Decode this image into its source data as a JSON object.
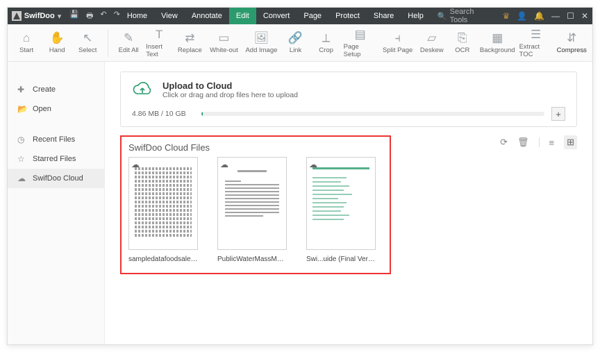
{
  "titlebar": {
    "app_name": "SwifDoo",
    "search_placeholder": "Search Tools"
  },
  "menu": {
    "items": [
      "Home",
      "View",
      "Annotate",
      "Edit",
      "Convert",
      "Page",
      "Protect",
      "Share",
      "Help"
    ],
    "active_index": 3
  },
  "ribbon": {
    "items": [
      {
        "label": "Start",
        "icon": "⌂"
      },
      {
        "label": "Hand",
        "icon": "✋"
      },
      {
        "label": "Select",
        "icon": "↖"
      },
      {
        "label": "Edit All",
        "icon": "✎"
      },
      {
        "label": "Insert Text",
        "icon": "T"
      },
      {
        "label": "Replace",
        "icon": "⇄"
      },
      {
        "label": "White-out",
        "icon": "▭"
      },
      {
        "label": "Add Image",
        "icon": "🖼"
      },
      {
        "label": "Link",
        "icon": "🔗"
      },
      {
        "label": "Crop",
        "icon": "⟂"
      },
      {
        "label": "Page Setup",
        "icon": "▤"
      },
      {
        "label": "Split Page",
        "icon": "⫞"
      },
      {
        "label": "Deskew",
        "icon": "▱"
      },
      {
        "label": "OCR",
        "icon": "⎘"
      },
      {
        "label": "Background",
        "icon": "▦"
      },
      {
        "label": "Extract TOC",
        "icon": "☰"
      },
      {
        "label": "Compress",
        "icon": "⇵"
      }
    ]
  },
  "sidebar": {
    "items": [
      {
        "label": "Create",
        "icon": "✚"
      },
      {
        "label": "Open",
        "icon": "📂"
      },
      {
        "label": "Recent Files",
        "icon": "◷"
      },
      {
        "label": "Starred Files",
        "icon": "☆"
      },
      {
        "label": "SwifDoo Cloud",
        "icon": "☁"
      }
    ],
    "active_index": 4
  },
  "upload": {
    "title": "Upload to Cloud",
    "subtitle": "Click or drag and drop files here to upload",
    "usage": "4.86 MB / 10 GB"
  },
  "files": {
    "section_title": "SwifDoo Cloud Files",
    "items": [
      {
        "name": "sampledatafoodsales.pdf",
        "kind": "table"
      },
      {
        "name": "PublicWaterMassMailing.pdf",
        "kind": "text"
      },
      {
        "name": "Swi...uide (Final Version).pdf",
        "kind": "toc"
      }
    ]
  }
}
